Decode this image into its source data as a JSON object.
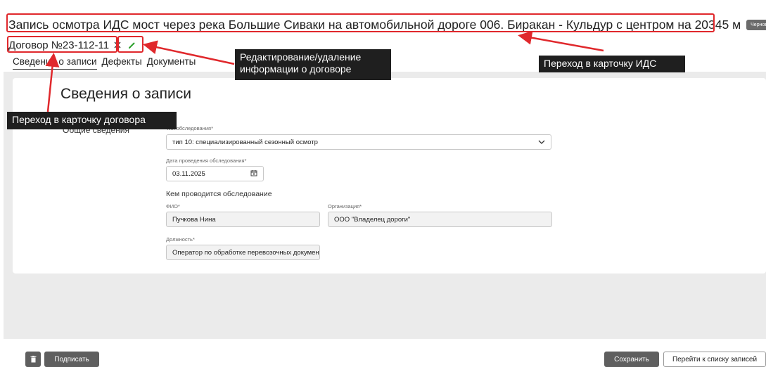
{
  "header": {
    "title": "Запись осмотра ИДС мост через река Большие Сиваки на автомобильной дороге 006. Биракан - Кульдур с центром на 20345 м",
    "status_badge": "Черновик",
    "contract_link": "Договор №23-112-11",
    "icons": {
      "remove": "close-icon",
      "edit": "pencil-icon"
    }
  },
  "tabs": [
    "Сведения о записи",
    "Дефекты",
    "Документы"
  ],
  "form": {
    "section_title": "Сведения о записи",
    "group_label": "Общие сведения",
    "survey_type": {
      "label": "Тип обследования*",
      "value": "тип 10: специализированный сезонный осмотр"
    },
    "survey_date": {
      "label": "Дата проведения обследования*",
      "value": "03.11.2025"
    },
    "conducted_by": "Кем проводится обследование",
    "fio": {
      "label": "ФИО*",
      "value": "Пучкова Нина"
    },
    "organization": {
      "label": "Организация*",
      "value": "ООО \"Владелец дороги\""
    },
    "position": {
      "label": "Должность*",
      "value": "Оператор по обработке перевозочных документов"
    }
  },
  "footer": {
    "sign": "Подписать",
    "save": "Сохранить",
    "to_list": "Перейти к списку записей"
  },
  "annotations": {
    "edit_delete": "Редактирование/удаление\nинформации о договоре",
    "to_ids_card": "Переход в карточку ИДС",
    "to_contract_card": "Переход в карточку договора"
  },
  "colors": {
    "annotation": "#e0282c",
    "callout_bg": "#1f1f1f",
    "workspace": "#ebebeb",
    "button_dark": "#5f5f5f"
  }
}
